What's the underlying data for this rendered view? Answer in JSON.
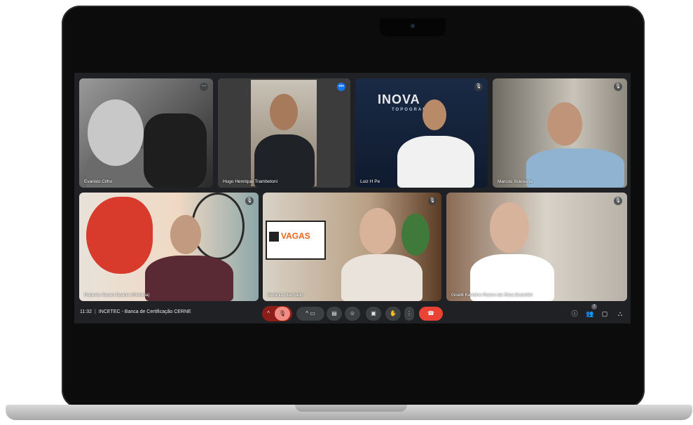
{
  "meeting": {
    "time": "11:32",
    "title": "INCETEC - Banca de Certificação CERNE"
  },
  "participants": [
    {
      "name": "Evaristo Cilho",
      "status_icon": "more-icon"
    },
    {
      "name": "Hugo Henrique Trambetoni",
      "status_icon": "speaking-icon"
    },
    {
      "name": "Luiz H Pe",
      "status_icon": "mic-off-icon"
    },
    {
      "name": "Marcos Sciesuna",
      "status_icon": "mic-off-icon"
    },
    {
      "name": "Roberto Nunes Duarte (Reitoria)",
      "status_icon": "mic-off-icon"
    },
    {
      "name": "Betânia Machado",
      "status_icon": "mic-off-icon"
    },
    {
      "name": "Giselli Karoline Roeno da Silva Dozinfiel",
      "status_icon": "mic-off-icon"
    }
  ],
  "background_signs": {
    "brand": "INOVA",
    "brand_sub": "TOPOGRAF",
    "vagas": "VAGAS"
  },
  "controls": {
    "participants_count": "7"
  },
  "colors": {
    "accent_blue": "#8ab4f8",
    "hangup_red": "#ea4335",
    "mic_off": "#f28b82",
    "bar_bg": "#202124"
  }
}
